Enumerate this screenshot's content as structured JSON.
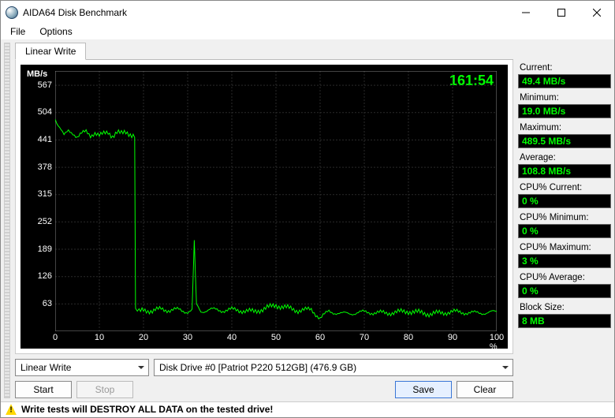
{
  "window": {
    "title": "AIDA64 Disk Benchmark"
  },
  "menus": {
    "file": "File",
    "options": "Options"
  },
  "tab": {
    "label": "Linear Write"
  },
  "chart_data": {
    "type": "line",
    "title": "",
    "xlabel": "",
    "ylabel": "MB/s",
    "xlim": [
      0,
      100
    ],
    "ylim": [
      0,
      600
    ],
    "xticks": [
      0,
      10,
      20,
      30,
      40,
      50,
      60,
      70,
      80,
      90,
      100
    ],
    "yticks": [
      63,
      126,
      189,
      252,
      315,
      378,
      441,
      504,
      567
    ],
    "xticklabels": [
      "0",
      "10",
      "20",
      "30",
      "40",
      "50",
      "60",
      "70",
      "80",
      "90",
      "100 %"
    ],
    "timer": "161:54",
    "series": [
      {
        "name": "Linear Write",
        "x": [
          0,
          1,
          2,
          3,
          4,
          5,
          6,
          7,
          8,
          9,
          10,
          11,
          12,
          13,
          14,
          15,
          16,
          17,
          18,
          18.2,
          19,
          20,
          22,
          24,
          26,
          28,
          30,
          31,
          31.5,
          32,
          33,
          35,
          38,
          40,
          45,
          50,
          55,
          58,
          60,
          62,
          65,
          70,
          75,
          80,
          85,
          90,
          95,
          100
        ],
        "y": [
          489,
          470,
          450,
          462,
          458,
          448,
          455,
          460,
          452,
          458,
          450,
          455,
          460,
          450,
          458,
          455,
          460,
          455,
          450,
          50,
          44,
          50,
          46,
          52,
          48,
          50,
          45,
          48,
          210,
          60,
          46,
          50,
          48,
          50,
          45,
          60,
          48,
          50,
          30,
          46,
          40,
          44,
          42,
          46,
          40,
          45,
          42,
          44
        ]
      }
    ]
  },
  "controls": {
    "mode_select": "Linear Write",
    "drive_select": "Disk Drive #0  [Patriot P220 512GB]  (476.9 GB)",
    "start": "Start",
    "stop": "Stop",
    "save": "Save",
    "clear": "Clear"
  },
  "stats": {
    "current_label": "Current:",
    "current_value": "49.4 MB/s",
    "minimum_label": "Minimum:",
    "minimum_value": "19.0 MB/s",
    "maximum_label": "Maximum:",
    "maximum_value": "489.5 MB/s",
    "average_label": "Average:",
    "average_value": "108.8 MB/s",
    "cpu_current_label": "CPU% Current:",
    "cpu_current_value": "0 %",
    "cpu_minimum_label": "CPU% Minimum:",
    "cpu_minimum_value": "0 %",
    "cpu_maximum_label": "CPU% Maximum:",
    "cpu_maximum_value": "3 %",
    "cpu_average_label": "CPU% Average:",
    "cpu_average_value": "0 %",
    "block_size_label": "Block Size:",
    "block_size_value": "8 MB"
  },
  "warning": "Write tests will DESTROY ALL DATA on the tested drive!"
}
